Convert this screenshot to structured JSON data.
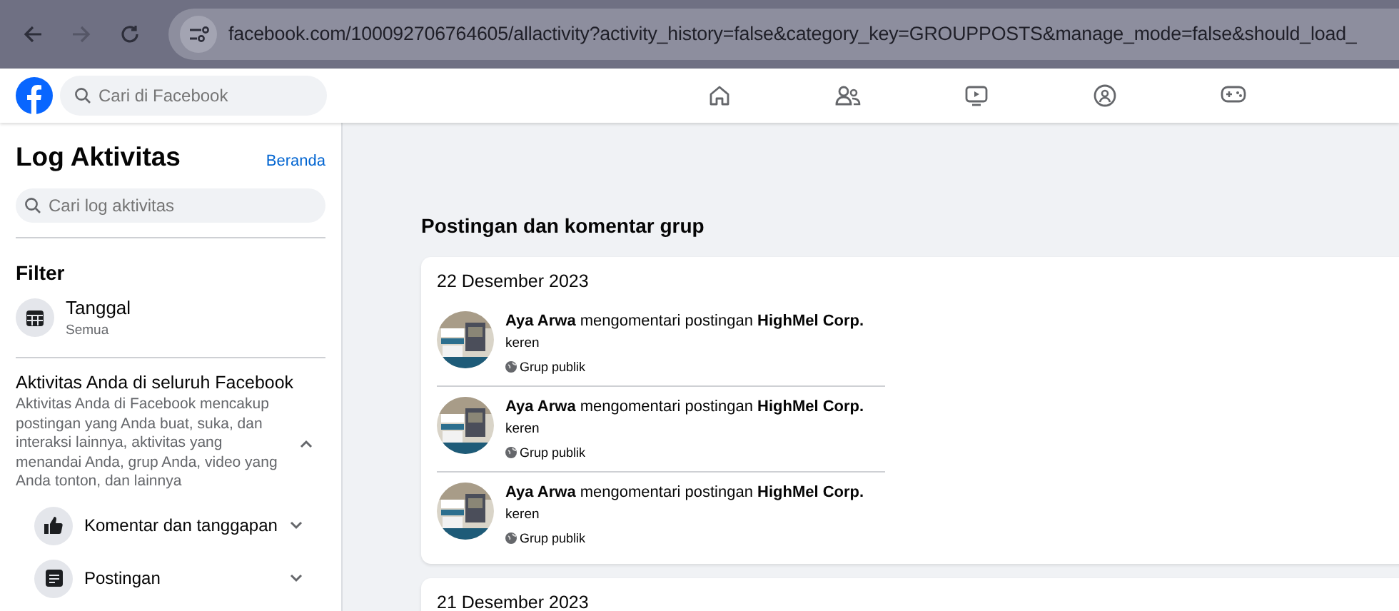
{
  "browser": {
    "url": "facebook.com/100092706764605/allactivity?activity_history=false&category_key=GROUPPOSTS&manage_mode=false&should_load_"
  },
  "topbar": {
    "search_placeholder": "Cari di Facebook"
  },
  "sidebar": {
    "title": "Log Aktivitas",
    "home_link": "Beranda",
    "search_placeholder": "Cari log aktivitas",
    "filter_heading": "Filter",
    "filters": [
      {
        "label": "Tanggal",
        "value": "Semua"
      }
    ],
    "section": {
      "title": "Aktivitas Anda di seluruh Facebook",
      "description": "Aktivitas Anda di Facebook mencakup postingan yang Anda buat, suka, dan interaksi lainnya, aktivitas yang menandai Anda, grup Anda, video yang Anda tonton, dan lainnya",
      "expanded": true
    },
    "categories": [
      {
        "kind": "like",
        "label": "Komentar dan tanggapan",
        "expanded": false
      },
      {
        "kind": "post",
        "label": "Postingan",
        "expanded": false
      }
    ]
  },
  "main": {
    "heading": "Postingan dan komentar grup",
    "days": [
      {
        "date": "22 Desember 2023",
        "entries": [
          {
            "text": "**Aya Arwa** mengomentari postingan **HighMel Corp.**",
            "comment": "keren",
            "audience": "Grup publik"
          },
          {
            "text": "**Aya Arwa** mengomentari postingan **HighMel Corp.**",
            "comment": "keren",
            "audience": "Grup publik"
          },
          {
            "text": "**Aya Arwa** mengomentari postingan **HighMel Corp.**",
            "comment": "keren",
            "audience": "Grup publik"
          }
        ]
      },
      {
        "date": "21 Desember 2023"
      }
    ]
  }
}
